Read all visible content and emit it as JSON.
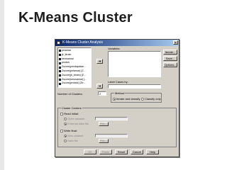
{
  "slide": {
    "title": "K-Means Cluster"
  },
  "dialog": {
    "title": "K-Means Cluster Analysis",
    "variables": [
      "pelamar",
      "jk_ktrain",
      "kerusamai",
      "produk",
      "Zscore(pendapatan...",
      "Zscore(pelamar) [Z...",
      "Zscore(jk_ktrain) [Z...",
      "Zscore(kerusamai) [...",
      "Zscore(produk) [Ze..."
    ],
    "variables_label": "Variables:",
    "label_cases_label": "Label Cases by:",
    "num_clusters_label": "Number of Clusters:",
    "num_clusters_value": "2",
    "method": {
      "title": "Method",
      "options": [
        "Iterate and classify",
        "Classify only"
      ]
    },
    "cluster_centers": {
      "title": "Cluster Centers",
      "read_initial": "Read initial:",
      "open_dataset": "Open dataset",
      "external_data_file": "External data file",
      "file_button": "File...",
      "write_final": "Write final:",
      "new_dataset": "New dataset",
      "data_file": "Data file",
      "file_button2": "File..."
    },
    "buttons": {
      "iterate": "Iterate...",
      "save": "Save...",
      "options": "Options..."
    },
    "bottom": [
      "OK",
      "Paste",
      "Reset",
      "Cancel",
      "Help"
    ]
  }
}
